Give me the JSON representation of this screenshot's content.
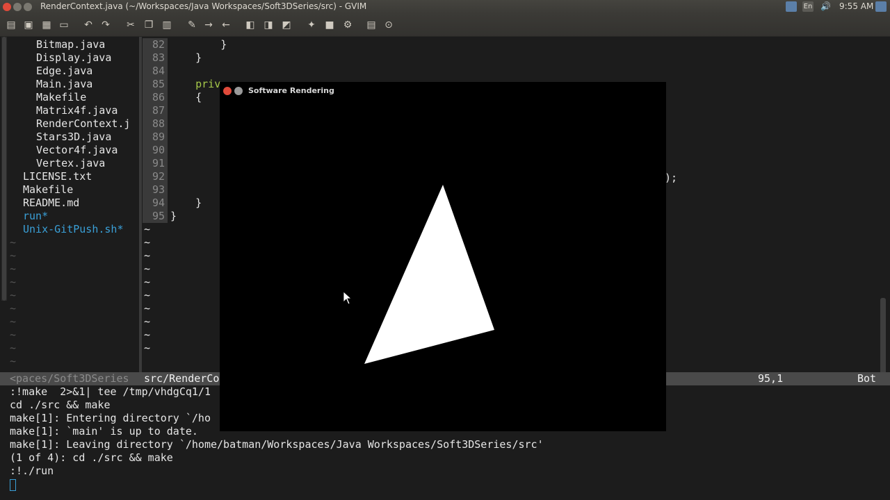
{
  "panel": {
    "title": "RenderContext.java (~/Workspaces/Java Workspaces/Soft3DSeries/src) - GVIM",
    "clock": "9:55 AM",
    "keyboard_layout": "En",
    "close_color": "#e04a3a"
  },
  "toolbar": {
    "icons": [
      "open-icon",
      "save-icon",
      "save-all-icon",
      "print-icon",
      "undo-icon",
      "redo-icon",
      "cut-icon",
      "copy-icon",
      "paste-icon",
      "find-replace-icon",
      "find-next-icon",
      "find-prev-icon",
      "load-session-icon",
      "save-session-icon",
      "run-script-icon",
      "make-icon",
      "shell-icon",
      "run-ctags-icon",
      "tag-jump-icon",
      "help-icon",
      "find-help-icon"
    ]
  },
  "tree": {
    "items": [
      {
        "label": "Bitmap.java",
        "indent": 2,
        "exec": false
      },
      {
        "label": "Display.java",
        "indent": 2,
        "exec": false
      },
      {
        "label": "Edge.java",
        "indent": 2,
        "exec": false
      },
      {
        "label": "Main.java",
        "indent": 2,
        "exec": false
      },
      {
        "label": "Makefile",
        "indent": 2,
        "exec": false
      },
      {
        "label": "Matrix4f.java",
        "indent": 2,
        "exec": false
      },
      {
        "label": "RenderContext.j",
        "indent": 2,
        "exec": false
      },
      {
        "label": "Stars3D.java",
        "indent": 2,
        "exec": false
      },
      {
        "label": "Vector4f.java",
        "indent": 2,
        "exec": false
      },
      {
        "label": "Vertex.java",
        "indent": 2,
        "exec": false
      },
      {
        "label": "LICENSE.txt",
        "indent": 1,
        "exec": false
      },
      {
        "label": "Makefile",
        "indent": 1,
        "exec": false
      },
      {
        "label": "README.md",
        "indent": 1,
        "exec": false
      },
      {
        "label": "run*",
        "indent": 1,
        "exec": true
      },
      {
        "label": "Unix-GitPush.sh*",
        "indent": 1,
        "exec": true
      }
    ],
    "filler": "~"
  },
  "editor": {
    "lines": [
      {
        "num": "82",
        "text": "        }"
      },
      {
        "num": "83",
        "text": "    }"
      },
      {
        "num": "84",
        "text": ""
      },
      {
        "num": "85",
        "text": "    priv"
      },
      {
        "num": "86",
        "text": "    {"
      },
      {
        "num": "87",
        "text": ""
      },
      {
        "num": "88",
        "text": ""
      },
      {
        "num": "89",
        "text": ""
      },
      {
        "num": "90",
        "text": ""
      },
      {
        "num": "91",
        "text": ""
      },
      {
        "num": "92",
        "text": ""
      },
      {
        "num": "93",
        "text": ""
      },
      {
        "num": "94",
        "text": "    }"
      },
      {
        "num": "95",
        "text": "}"
      }
    ],
    "right_fragment": ");",
    "filler": "~"
  },
  "status": {
    "left_path": "<paces/Soft3DSeries",
    "file": "src/RenderCo",
    "position": "95,1",
    "scroll": "Bot"
  },
  "command_output": {
    "lines": [
      ":!make  2>&1| tee /tmp/vhdgCq1/1",
      "cd ./src && make",
      "make[1]: Entering directory `/ho",
      "make[1]: `main' is up to date.",
      "make[1]: Leaving directory `/home/batman/Workspaces/Java Workspaces/Soft3DSeries/src'",
      "(1 of 4): cd ./src && make",
      ":!./run"
    ]
  },
  "render_window": {
    "title": "Software Rendering",
    "triangle_color": "#ffffff",
    "background_color": "#000000"
  }
}
